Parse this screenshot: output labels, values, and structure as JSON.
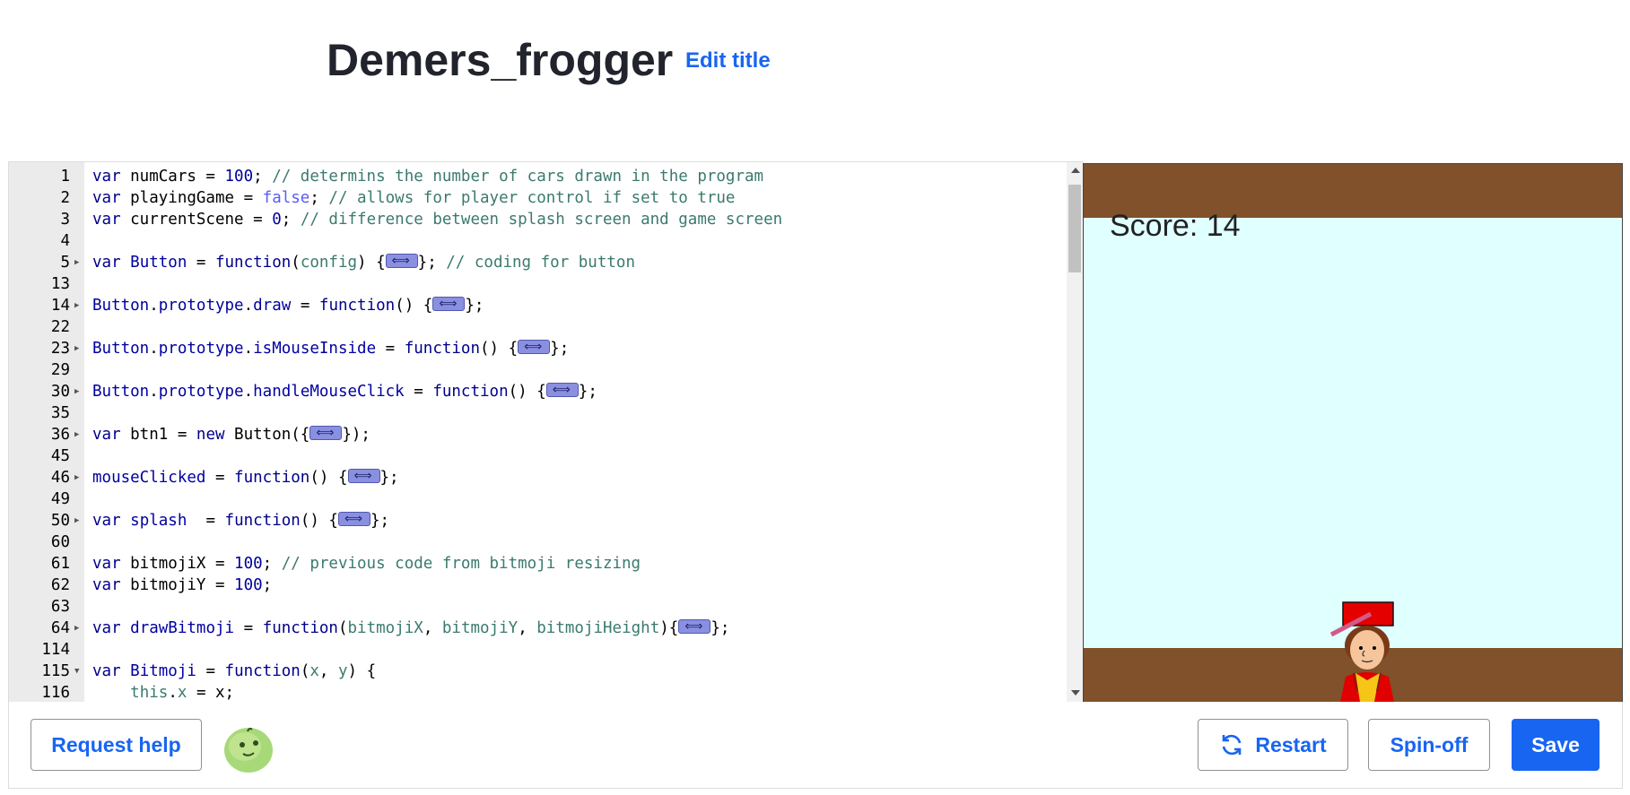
{
  "header": {
    "title": "Demers_frogger",
    "edit_title_label": "Edit title"
  },
  "editor": {
    "lines": [
      {
        "n": "1",
        "html": "<span class=\"kw\">var</span> numCars = <span class=\"num\">100</span>; <span class=\"cm\">// determins the number of cars drawn in the program</span>"
      },
      {
        "n": "2",
        "html": "<span class=\"kw\">var</span> playingGame = <span class=\"lit\">false</span>; <span class=\"cm\">// allows for player control if set to true</span>"
      },
      {
        "n": "3",
        "html": "<span class=\"kw\">var</span> currentScene = <span class=\"num\">0</span>; <span class=\"cm\">// difference between splash screen and game screen</span>"
      },
      {
        "n": "4",
        "html": ""
      },
      {
        "n": "5",
        "fold": true,
        "html": "<span class=\"kw\">var</span> <span class=\"fn\">Button</span> = <span class=\"kw\">function</span>(<span class=\"prm\">config</span>) {<span class=\"foldmark\"></span>}; <span class=\"cm\">// coding for button</span>"
      },
      {
        "n": "13",
        "html": ""
      },
      {
        "n": "14",
        "fold": true,
        "html": "<span class=\"fn\">Button</span>.<span class=\"fn\">prototype</span>.<span class=\"fn\">draw</span> = <span class=\"kw\">function</span>() {<span class=\"foldmark\"></span>};"
      },
      {
        "n": "22",
        "html": ""
      },
      {
        "n": "23",
        "fold": true,
        "html": "<span class=\"fn\">Button</span>.<span class=\"fn\">prototype</span>.<span class=\"fn\">isMouseInside</span> = <span class=\"kw\">function</span>() {<span class=\"foldmark\"></span>};"
      },
      {
        "n": "29",
        "html": ""
      },
      {
        "n": "30",
        "fold": true,
        "html": "<span class=\"fn\">Button</span>.<span class=\"fn\">prototype</span>.<span class=\"fn\">handleMouseClick</span> = <span class=\"kw\">function</span>() {<span class=\"foldmark\"></span>};"
      },
      {
        "n": "35",
        "html": ""
      },
      {
        "n": "36",
        "fold": true,
        "html": "<span class=\"kw\">var</span> btn1 = <span class=\"kw\">new</span> Button({<span class=\"foldmark\"></span>});"
      },
      {
        "n": "45",
        "html": ""
      },
      {
        "n": "46",
        "fold": true,
        "html": "<span class=\"fn\">mouseClicked</span> = <span class=\"kw\">function</span>() {<span class=\"foldmark\"></span>};"
      },
      {
        "n": "49",
        "html": ""
      },
      {
        "n": "50",
        "fold": true,
        "html": "<span class=\"kw\">var</span> <span class=\"fn\">splash</span>  = <span class=\"kw\">function</span>() {<span class=\"foldmark\"></span>};"
      },
      {
        "n": "60",
        "html": ""
      },
      {
        "n": "61",
        "html": "<span class=\"kw\">var</span> bitmojiX = <span class=\"num\">100</span>; <span class=\"cm\">// previous code from bitmoji resizing</span>"
      },
      {
        "n": "62",
        "html": "<span class=\"kw\">var</span> bitmojiY = <span class=\"num\">100</span>;"
      },
      {
        "n": "63",
        "html": ""
      },
      {
        "n": "64",
        "fold": true,
        "html": "<span class=\"kw\">var</span> <span class=\"fn\">drawBitmoji</span> = <span class=\"kw\">function</span>(<span class=\"prm\">bitmojiX</span>, <span class=\"prm\">bitmojiY</span>, <span class=\"prm\">bitmojiHeight</span>){<span class=\"foldmark\"></span>};"
      },
      {
        "n": "114",
        "html": ""
      },
      {
        "n": "115",
        "fold": true,
        "open": true,
        "html": "<span class=\"kw\">var</span> <span class=\"fn\">Bitmoji</span> = <span class=\"kw\">function</span>(<span class=\"prm\">x</span>, <span class=\"prm\">y</span>) {"
      },
      {
        "n": "116",
        "html": "    <span class=\"prm\">this</span>.<span class=\"prm\">x</span> = x;"
      }
    ]
  },
  "canvas": {
    "score_text": "Score: 14",
    "ground_color": "#80512a",
    "sky_color": "#e0ffff"
  },
  "footer": {
    "request_help_label": "Request help",
    "restart_label": "Restart",
    "spinoff_label": "Spin-off",
    "save_label": "Save",
    "avatar_icon": "green-blob-avatar-icon"
  }
}
